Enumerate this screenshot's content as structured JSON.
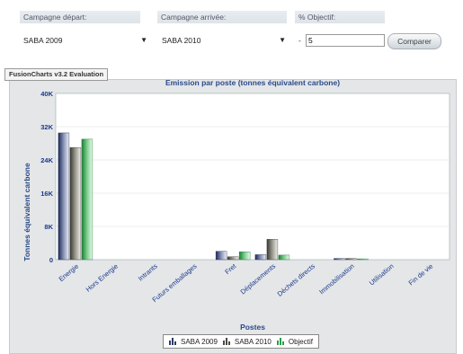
{
  "form": {
    "start_label": "Campagne départ:",
    "end_label": "Campagne arrivée:",
    "objective_label": "% Objectif:",
    "start_value": "SABA 2009",
    "end_value": "SABA 2010",
    "objective_prefix": "- ",
    "objective_value": "5",
    "compare_label": "Comparer"
  },
  "eval_tag": "FusionCharts v3.2 Evaluation",
  "icons": {
    "dropdown": "chevron-down-icon",
    "legend": "column-chart-icon"
  },
  "colors": {
    "series_2009": "#2c3a66",
    "series_2010": "#4a4a44",
    "series_objectif": "#2f9a4a",
    "axis": "#1a3a8a"
  },
  "chart_data": {
    "type": "bar",
    "title": "Emission par poste (tonnes équivalent carbone)",
    "xlabel": "Postes",
    "ylabel": "Tonnes équivalent carbone",
    "ylim": [
      0,
      40000
    ],
    "yticks": [
      "0",
      "8K",
      "16K",
      "24K",
      "32K",
      "40K"
    ],
    "categories": [
      "Energie",
      "Hors Energie",
      "Intrants",
      "Futurs emballages",
      "Fret",
      "Déplacements",
      "Déchets directs",
      "Immobilisation",
      "Utilisation",
      "Fin de vie"
    ],
    "series": [
      {
        "name": "SABA 2009",
        "values": [
          30500,
          0,
          0,
          0,
          2000,
          1200,
          0,
          300,
          0,
          0
        ]
      },
      {
        "name": "SABA 2010",
        "values": [
          27000,
          0,
          0,
          0,
          700,
          4900,
          0,
          300,
          0,
          0
        ]
      },
      {
        "name": "Objectif",
        "values": [
          29000,
          0,
          0,
          0,
          1900,
          1100,
          0,
          200,
          0,
          0
        ]
      }
    ],
    "grid": true,
    "legend_position": "bottom"
  }
}
